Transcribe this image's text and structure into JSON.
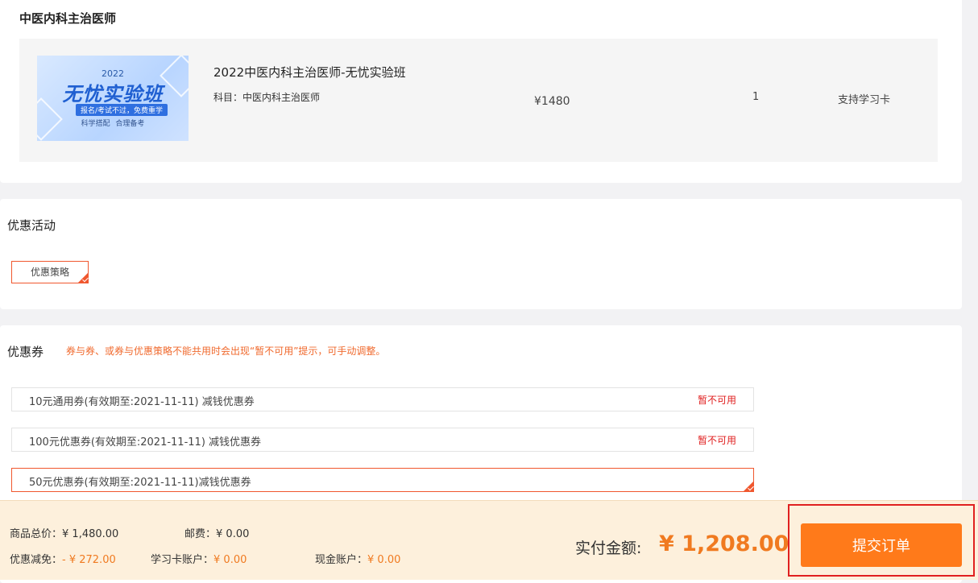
{
  "order": {
    "category_title": "中医内科主治医师",
    "course": {
      "thumb_year": "2022",
      "thumb_title": "无忧实验班",
      "thumb_tag": "报名/考试不过，免费重学",
      "thumb_sub": "科学搭配 合理备考",
      "name": "2022中医内科主治医师-无忧实验班",
      "subject": "科目：中医内科主治医师",
      "price": "¥1480",
      "quantity": "1",
      "card_support": "支持学习卡"
    }
  },
  "promotion": {
    "title": "优惠活动",
    "tag_label": "优惠策略"
  },
  "coupons": {
    "title": "优惠券",
    "hint": "券与券、或券与优惠策略不能共用时会出现“暂不可用”提示，可手动调整。",
    "items": [
      {
        "text": "10元通用券(有效期至:2021-11-11) 减钱优惠券",
        "status": "暂不可用"
      },
      {
        "text": "100元优惠券(有效期至:2021-11-11) 减钱优惠券",
        "status": "暂不可用"
      },
      {
        "text": "50元优惠券(有效期至:2021-11-11)减钱优惠券",
        "status": ""
      }
    ]
  },
  "footer": {
    "goods_total_label": "商品总价：",
    "goods_total_value": "¥ 1,480.00",
    "postage_label": "邮费：",
    "postage_value": "¥ 0.00",
    "discount_label": "优惠减免：",
    "discount_value": "- ¥ 272.00",
    "card_account_label": "学习卡账户：",
    "card_account_value": "¥ 0.00",
    "cash_account_label": "现金账户：",
    "cash_account_value": "¥ 0.00",
    "pay_label": "实付金额:",
    "pay_value": "¥ 1,208.00",
    "submit_label": "提交订单"
  },
  "colors": {
    "accent": "#ff7a1a",
    "price_orange": "#f07a20",
    "unavailable_red": "#e02020",
    "selected_border": "#f0572e"
  }
}
